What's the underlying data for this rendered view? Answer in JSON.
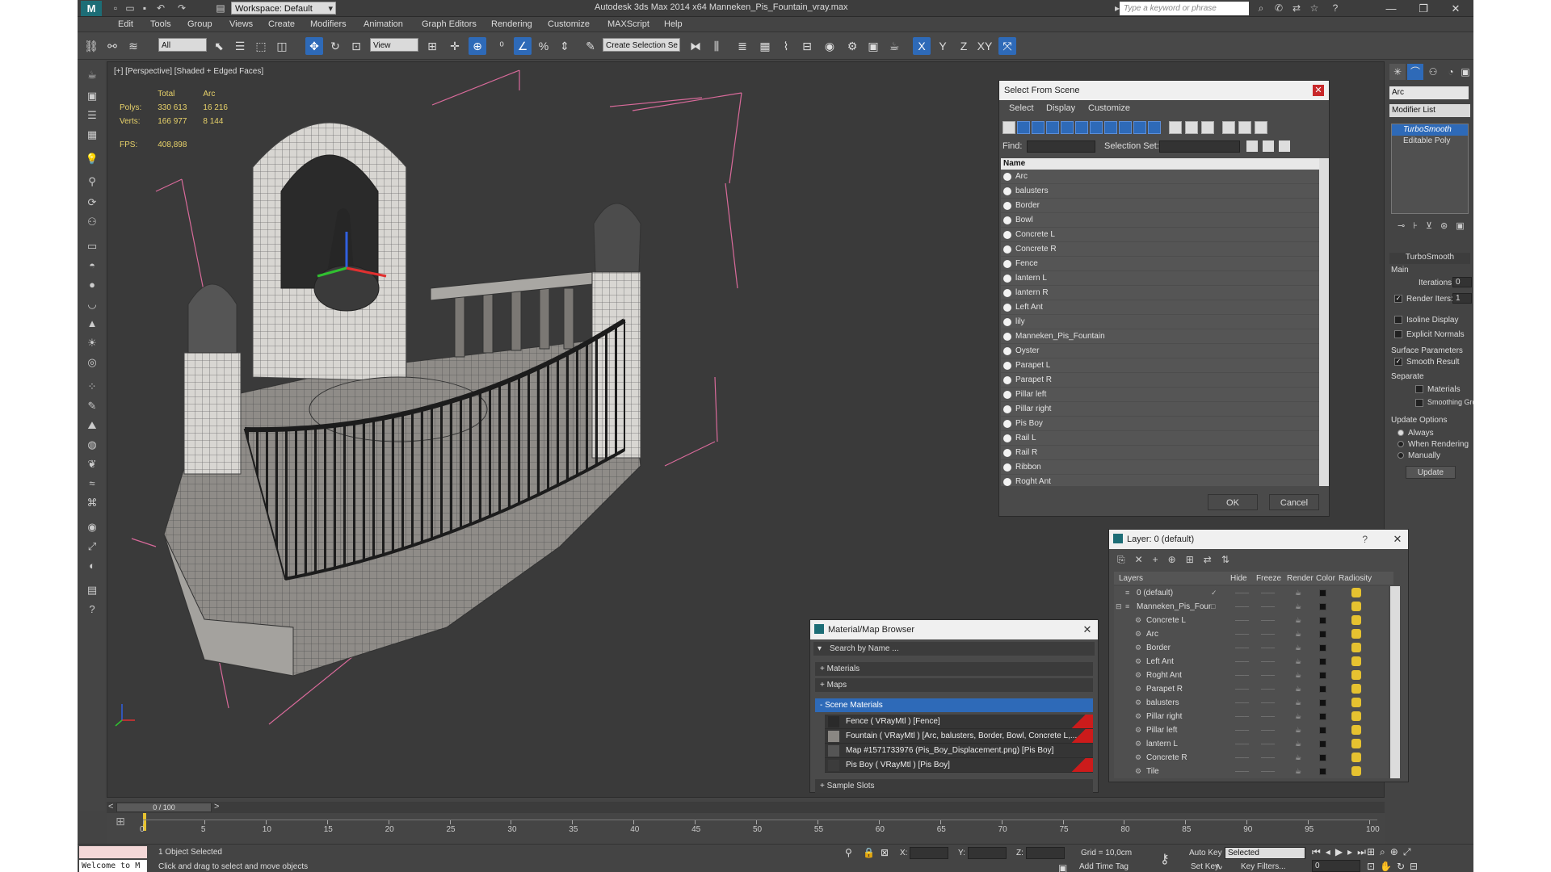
{
  "app": {
    "title": "Autodesk 3ds Max  2014 x64     Manneken_Pis_Fountain_vray.max",
    "workspace": "Workspace: Default",
    "search_placeholder": "Type a keyword or phrase"
  },
  "menu": [
    "Edit",
    "Tools",
    "Group",
    "Views",
    "Create",
    "Modifiers",
    "Animation",
    "Graph Editors",
    "Rendering",
    "Customize",
    "MAXScript",
    "Help"
  ],
  "toolbar": {
    "filter": "All",
    "coord": "View",
    "selection_set": "Create Selection Se",
    "axes": [
      "X",
      "Y",
      "Z",
      "XY"
    ]
  },
  "viewport": {
    "label": "[+] [Perspective] [Shaded + Edged Faces]",
    "stats": {
      "col_total": "Total",
      "col_arc": "Arc",
      "polys_label": "Polys:",
      "polys_total": "330 613",
      "polys_arc": "16 216",
      "verts_label": "Verts:",
      "verts_total": "166 977",
      "verts_arc": "8 144",
      "fps_label": "FPS:",
      "fps_value": "408,898"
    }
  },
  "select_from_scene": {
    "title": "Select From Scene",
    "menu": [
      "Select",
      "Display",
      "Customize"
    ],
    "find_label": "Find:",
    "selection_set_label": "Selection Set:",
    "column": "Name",
    "items": [
      "Arc",
      "balusters",
      "Border",
      "Bowl",
      "Concrete L",
      "Concrete R",
      "Fence",
      "lantern L",
      "lantern R",
      "Left Ant",
      "lily",
      "Manneken_Pis_Fountain",
      "Oyster",
      "Parapet L",
      "Parapet R",
      "Pillar left",
      "Pillar right",
      "Pis Boy",
      "Rail L",
      "Rail R",
      "Ribbon",
      "Roght Ant"
    ],
    "ok": "OK",
    "cancel": "Cancel"
  },
  "command_panel": {
    "object_name": "Arc",
    "modifier_list": "Modifier List",
    "stack": [
      "TurboSmooth",
      "Editable Poly"
    ],
    "rollout": "TurboSmooth",
    "main": "Main",
    "iterations_label": "Iterations:",
    "iterations": "0",
    "render_iters_label": "Render Iters:",
    "render_iters": "1",
    "isoline": "Isoline Display",
    "explicit_normals": "Explicit Normals",
    "surface_params": "Surface Parameters",
    "smooth_result": "Smooth Result",
    "separate": "Separate",
    "materials": "Materials",
    "smoothing_groups": "Smoothing Groups",
    "update_options": "Update Options",
    "always": "Always",
    "when_rendering": "When Rendering",
    "manually": "Manually",
    "update": "Update"
  },
  "layer_dialog": {
    "title": "Layer: 0 (default)",
    "help": "?",
    "columns": [
      "Layers",
      "Hide",
      "Freeze",
      "Render",
      "Color",
      "Radiosity"
    ],
    "rows": [
      "0 (default)",
      "Manneken_Pis_Fountain",
      "Concrete L",
      "Arc",
      "Border",
      "Left Ant",
      "Roght Ant",
      "Parapet R",
      "balusters",
      "Pillar right",
      "Pillar left",
      "lantern L",
      "Concrete R",
      "Tile"
    ]
  },
  "material_browser": {
    "title": "Material/Map Browser",
    "search_placeholder": "Search by Name ...",
    "sections": [
      "+ Materials",
      "+ Maps",
      "- Scene Materials"
    ],
    "items": [
      "Fence  ( VRayMtl )  [Fence]",
      "Fountain  ( VRayMtl )  [Arc, balusters, Border, Bowl, Concrete L,...",
      "Map #1571733976 (Pis_Boy_Displacement.png) [Pis Boy]",
      "Pis Boy  ( VRayMtl )  [Pis Boy]"
    ],
    "sample_slots": "+ Sample Slots"
  },
  "timeline": {
    "frame": "0 / 100",
    "ticks": [
      "0",
      "5",
      "10",
      "15",
      "20",
      "25",
      "30",
      "35",
      "40",
      "45",
      "50",
      "55",
      "60",
      "65",
      "70",
      "75",
      "80",
      "85",
      "90",
      "95",
      "100"
    ]
  },
  "status": {
    "welcome": "Welcome to M",
    "selected": "1 Object Selected",
    "hint": "Click and drag to select and move objects",
    "x": "X:",
    "y": "Y:",
    "z": "Z:",
    "grid": "Grid = 10,0cm",
    "auto_key": "Auto Key",
    "selected_mode": "Selected",
    "set_key": "Set Key",
    "key_filters": "Key Filters...",
    "add_time_tag": "Add Time Tag",
    "frame_value": "0"
  },
  "colors": {
    "accent": "#2e6ab8",
    "ui_bg": "#444444",
    "gizmo_red": "#e03030",
    "gizmo_green": "#30c030",
    "gizmo_blue": "#3060e0"
  }
}
